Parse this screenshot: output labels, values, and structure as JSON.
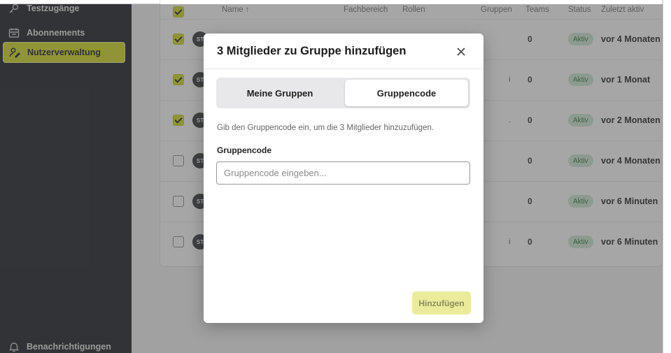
{
  "sidebar": {
    "items": [
      {
        "label": "Testzugänge",
        "icon": "key-icon"
      },
      {
        "label": "Abonnements",
        "icon": "calendar-icon"
      },
      {
        "label": "Nutzerverwaltung",
        "icon": "user-edit-icon",
        "active": true
      }
    ],
    "bottom_item": {
      "label": "Benachrichtigungen",
      "icon": "bell-icon"
    }
  },
  "table": {
    "headers": {
      "name": "Name ↑",
      "fachbereich": "Fachbereich",
      "rollen": "Rollen",
      "gruppen": "Gruppen",
      "teams": "Teams",
      "status": "Status",
      "last_active": "Zuletzt aktiv"
    },
    "rows": [
      {
        "checked": true,
        "avatar": "ST",
        "teams": "0",
        "status": "Aktiv",
        "last_active": "vor 4 Monaten",
        "gruppen_frag": ""
      },
      {
        "checked": true,
        "avatar": "ST",
        "teams": "0",
        "status": "Aktiv",
        "last_active": "vor 1 Monat",
        "gruppen_frag": "i"
      },
      {
        "checked": true,
        "avatar": "ST",
        "teams": "0",
        "status": "Aktiv",
        "last_active": "vor 2 Monaten",
        "gruppen_frag": "."
      },
      {
        "checked": false,
        "avatar": "ST",
        "teams": "0",
        "status": "Aktiv",
        "last_active": "vor 4 Monaten",
        "gruppen_frag": ""
      },
      {
        "checked": false,
        "avatar": "ST",
        "teams": "0",
        "status": "Aktiv",
        "last_active": "vor 6 Minuten",
        "gruppen_frag": ""
      },
      {
        "checked": false,
        "avatar": "ST",
        "teams": "0",
        "status": "Aktiv",
        "last_active": "vor 6 Minuten",
        "gruppen_frag": "i"
      }
    ]
  },
  "modal": {
    "title": "3 Mitglieder zu Gruppe hinzufügen",
    "tabs": [
      {
        "label": "Meine Gruppen",
        "selected": false
      },
      {
        "label": "Gruppencode",
        "selected": true
      }
    ],
    "description": "Gib den Gruppencode ein, um die 3 Mitglieder hinzuzufügen.",
    "field_label": "Gruppencode",
    "input_value": "",
    "input_placeholder": "Gruppencode eingeben...",
    "submit_label": "Hinzufügen"
  },
  "colors": {
    "accent": "#d7dc2a",
    "sidebar_bg": "#222429",
    "badge_bg": "#cfe9d3",
    "badge_text": "#2e7d3a",
    "button_disabled_bg": "#eaec9b"
  }
}
